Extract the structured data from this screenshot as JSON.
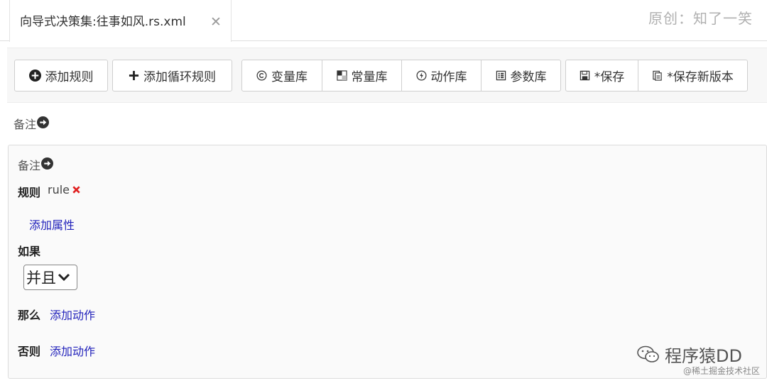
{
  "tab": {
    "title": "向导式决策集:往事如风.rs.xml",
    "close_icon": "close-icon"
  },
  "watermark_top": "原创：知了一笑",
  "toolbar": {
    "add_rule": "添加规则",
    "add_loop_rule": "添加循环规则",
    "variable_lib": "变量库",
    "constant_lib": "常量库",
    "action_lib": "动作库",
    "parameter_lib": "参数库",
    "save": "*保存",
    "save_new_version": "*保存新版本"
  },
  "remark_label": "备注",
  "rule": {
    "remark_label": "备注",
    "rule_label": "规则",
    "rule_name": "rule",
    "add_attribute": "添加属性",
    "if_label": "如果",
    "condition_select": "并且",
    "then_label": "那么",
    "then_add_action": "添加动作",
    "else_label": "否则",
    "else_add_action": "添加动作"
  },
  "watermark_bottom": {
    "name": "程序猿DD",
    "community": "@稀土掘金技术社区"
  },
  "colors": {
    "link": "#2222bb",
    "delete": "#e02020",
    "panel_bg": "#fafafa"
  }
}
